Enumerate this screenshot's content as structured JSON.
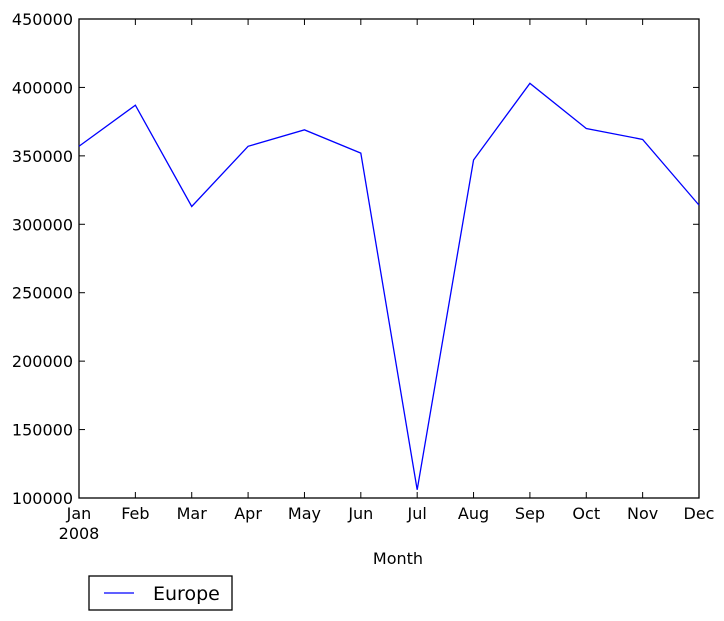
{
  "chart_data": {
    "type": "line",
    "title": "",
    "xlabel": "Month",
    "ylabel": "",
    "categories": [
      "Jan",
      "Feb",
      "Mar",
      "Apr",
      "May",
      "Jun",
      "Jul",
      "Aug",
      "Sep",
      "Oct",
      "Nov",
      "Dec"
    ],
    "x_sublabel": "2008",
    "ylim": [
      100000,
      450000
    ],
    "yticks": [
      100000,
      150000,
      200000,
      250000,
      300000,
      350000,
      400000,
      450000
    ],
    "ytick_labels": [
      "100000",
      "150000",
      "200000",
      "250000",
      "300000",
      "350000",
      "400000",
      "450000"
    ],
    "grid": false,
    "legend_position": "below-left",
    "series": [
      {
        "name": "Europe",
        "color": "#0000ff",
        "values": [
          357000,
          387000,
          313000,
          357000,
          369000,
          352000,
          106000,
          347000,
          403000,
          370000,
          362000,
          314000
        ]
      }
    ]
  }
}
